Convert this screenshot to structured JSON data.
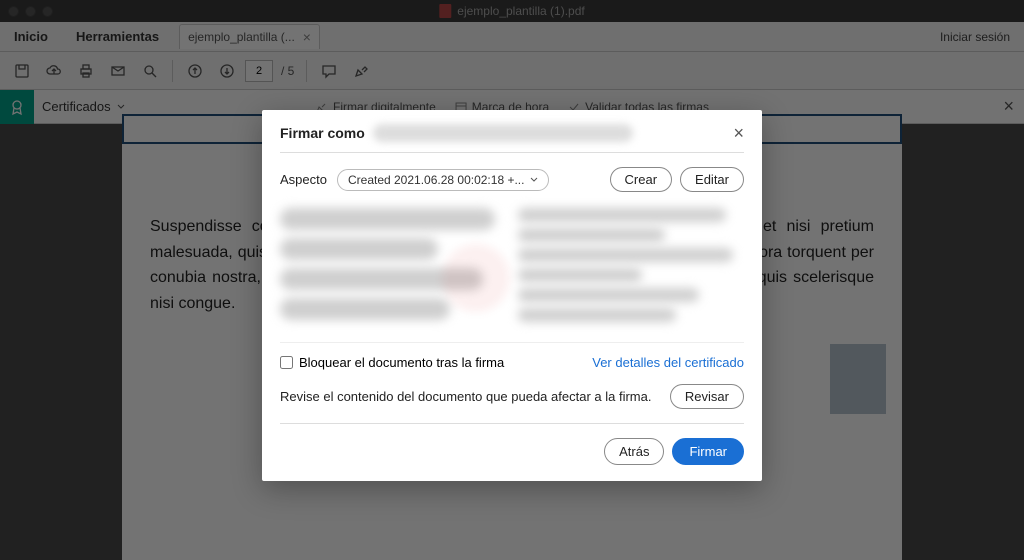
{
  "titlebar": {
    "filename": "ejemplo_plantilla (1).pdf"
  },
  "tabs": {
    "home": "Inicio",
    "tools": "Herramientas",
    "doc": "ejemplo_plantilla (...",
    "signin": "Iniciar sesión"
  },
  "toolbar": {
    "page_current": "2",
    "page_total": "/ 5"
  },
  "certbar": {
    "label": "Certificados",
    "action1": "Firmar digitalmente",
    "action2": "Marca de hora",
    "action3": "Validar todas las firmas"
  },
  "document": {
    "body": "Suspendisse consequat urna ex, a ultricies dui rutrum quis. Nullam at augue et nisi pretium malesuada, quis pulvinar libero enim sit amet tortor. Class aptent taciti sociosqu ad litora torquent per conubia nostra, per inceptos himenaeos. Sed ac velit ut erat faucibus pellentesque quis scelerisque nisi congue."
  },
  "modal": {
    "title": "Firmar como",
    "aspect_label": "Aspecto",
    "aspect_value": "Created 2021.06.28 00:02:18 +...",
    "create": "Crear",
    "edit": "Editar",
    "lock_label": "Bloquear el documento tras la firma",
    "cert_link": "Ver detalles del certificado",
    "review_text": "Revise el contenido del documento que pueda afectar a la firma.",
    "review_btn": "Revisar",
    "back": "Atrás",
    "sign": "Firmar"
  }
}
